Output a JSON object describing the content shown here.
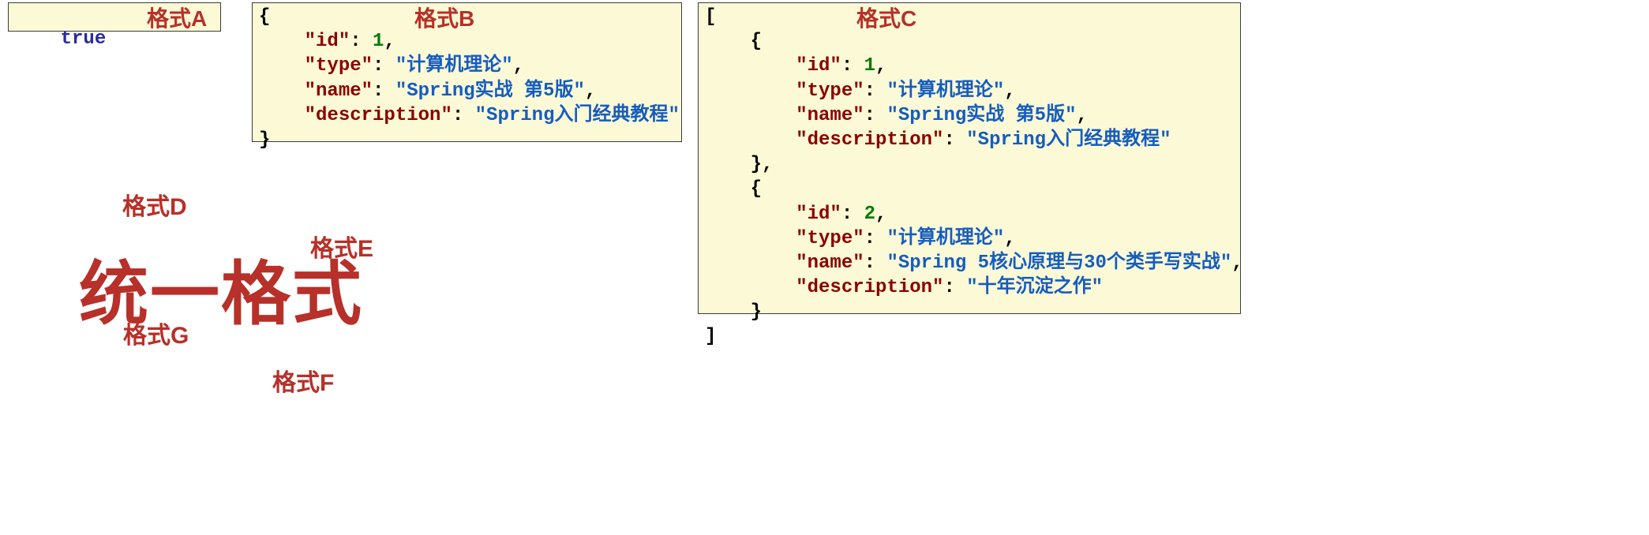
{
  "boxA": {
    "label": "格式A",
    "content": "true"
  },
  "boxB": {
    "label": "格式B",
    "lines": {
      "open": "{",
      "id_line": {
        "pad": "    ",
        "key": "\"id\"",
        "colon": ": ",
        "val": "1",
        "comma": ","
      },
      "type_line": {
        "pad": "    ",
        "key": "\"type\"",
        "colon": ": ",
        "val": "\"计算机理论\"",
        "comma": ","
      },
      "name_line": {
        "pad": "    ",
        "key": "\"name\"",
        "colon": ": ",
        "val": "\"Spring实战 第5版\"",
        "comma": ","
      },
      "desc_line": {
        "pad": "    ",
        "key": "\"description\"",
        "colon": ": ",
        "val": "\"Spring入门经典教程\"",
        "comma": ""
      },
      "close": "}"
    }
  },
  "boxC": {
    "label": "格式C",
    "lines": {
      "open_arr": "[",
      "open1": "    {",
      "id1": {
        "pad": "        ",
        "key": "\"id\"",
        "colon": ": ",
        "val": "1",
        "comma": ","
      },
      "type1": {
        "pad": "        ",
        "key": "\"type\"",
        "colon": ": ",
        "val": "\"计算机理论\"",
        "comma": ","
      },
      "name1": {
        "pad": "        ",
        "key": "\"name\"",
        "colon": ": ",
        "val": "\"Spring实战 第5版\"",
        "comma": ","
      },
      "desc1": {
        "pad": "        ",
        "key": "\"description\"",
        "colon": ": ",
        "val": "\"Spring入门经典教程\"",
        "comma": ""
      },
      "close1": "    },",
      "open2": "    {",
      "id2": {
        "pad": "        ",
        "key": "\"id\"",
        "colon": ": ",
        "val": "2",
        "comma": ","
      },
      "type2": {
        "pad": "        ",
        "key": "\"type\"",
        "colon": ": ",
        "val": "\"计算机理论\"",
        "comma": ","
      },
      "name2": {
        "pad": "        ",
        "key": "\"name\"",
        "colon": ": ",
        "val": "\"Spring 5核心原理与30个类手写实战\"",
        "comma": ","
      },
      "desc2": {
        "pad": "        ",
        "key": "\"description\"",
        "colon": ": ",
        "val": "\"十年沉淀之作\"",
        "comma": ""
      },
      "close2": "    }",
      "close_arr": "]"
    }
  },
  "labels": {
    "D": "格式D",
    "E": "格式E",
    "F": "格式F",
    "G": "格式G",
    "unified": "统一格式"
  }
}
